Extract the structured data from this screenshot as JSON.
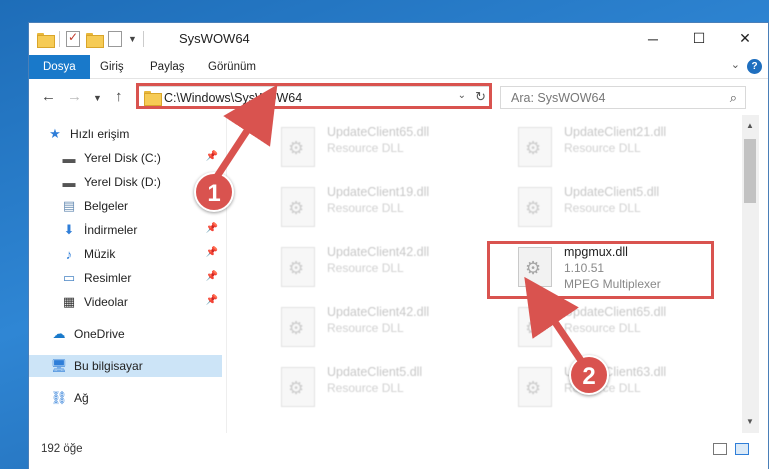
{
  "window": {
    "title": "SysWOW64"
  },
  "ribbon": {
    "tabs": [
      "Dosya",
      "Giriş",
      "Paylaş",
      "Görünüm"
    ],
    "help": "?"
  },
  "nav": {
    "address": "C:\\Windows\\SysWOW64",
    "search_placeholder": "Ara: SysWOW64"
  },
  "sidebar": {
    "items": [
      {
        "label": "Hızlı erişim",
        "icon": "star-icon"
      },
      {
        "label": "Yerel Disk (C:)",
        "icon": "drive-icon",
        "pinned": true
      },
      {
        "label": "Yerel Disk (D:)",
        "icon": "drive-icon"
      },
      {
        "label": "Belgeler",
        "icon": "documents-icon",
        "pinned": true
      },
      {
        "label": "İndirmeler",
        "icon": "download-icon",
        "pinned": true
      },
      {
        "label": "Müzik",
        "icon": "music-icon",
        "pinned": true
      },
      {
        "label": "Resimler",
        "icon": "pictures-icon",
        "pinned": true
      },
      {
        "label": "Videolar",
        "icon": "videos-icon",
        "pinned": true
      },
      {
        "label": "OneDrive",
        "icon": "cloud-icon"
      },
      {
        "label": "Bu bilgisayar",
        "icon": "computer-icon",
        "selected": true
      },
      {
        "label": "Ağ",
        "icon": "network-icon"
      }
    ]
  },
  "files": [
    {
      "name": "UpdateClient65.dll",
      "desc": "Resource DLL"
    },
    {
      "name": "UpdateClient21.dll",
      "desc": "Resource DLL"
    },
    {
      "name": "UpdateClient19.dll",
      "desc": "Resource DLL"
    },
    {
      "name": "UpdateClient5.dll",
      "desc": "Resource DLL"
    },
    {
      "name": "UpdateClient42.dll",
      "desc": "Resource DLL"
    },
    {
      "name": "mpgmux.dll",
      "desc": "1.10.51",
      "desc2": "MPEG Multiplexer"
    },
    {
      "name": "UpdateClient42.dll",
      "desc": "Resource DLL"
    },
    {
      "name": "UpdateClient65.dll",
      "desc": "Resource DLL"
    },
    {
      "name": "UpdateClient5.dll",
      "desc": "Resource DLL"
    },
    {
      "name": "UpdateClient63.dll",
      "desc": "Resource DLL"
    }
  ],
  "status": {
    "count": "192 öğe"
  },
  "badges": [
    "1",
    "2"
  ],
  "colors": {
    "accent": "#1979ca",
    "highlight": "#d9534f"
  }
}
